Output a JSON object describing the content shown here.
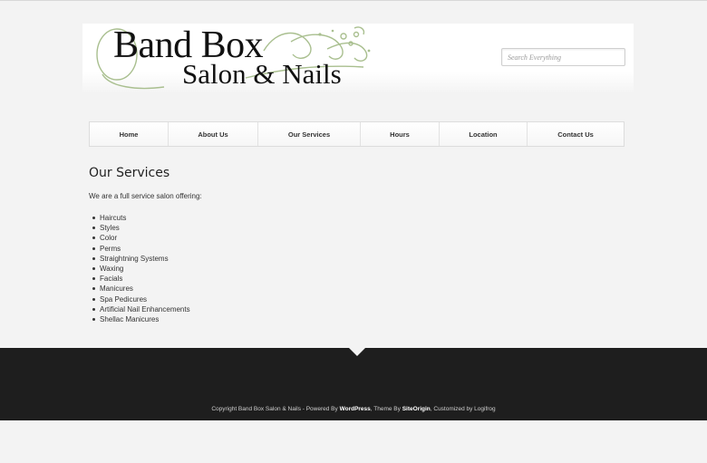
{
  "header": {
    "logo_line1": "Band Box",
    "logo_line2": "Salon & Nails",
    "search_placeholder": "Search Everything"
  },
  "nav": {
    "items": [
      {
        "label": "Home"
      },
      {
        "label": "About Us"
      },
      {
        "label": "Our Services"
      },
      {
        "label": "Hours"
      },
      {
        "label": "Location"
      },
      {
        "label": "Contact Us"
      }
    ]
  },
  "main": {
    "title": "Our Services",
    "intro": "We are a full service salon offering:",
    "services": [
      "Haircuts",
      "Styles",
      "Color",
      "Perms",
      "Straightning Systems",
      "Waxing",
      "Facials",
      "Manicures",
      "Spa Pedicures",
      "Artificial Nail Enhancements",
      "Shellac Manicures"
    ]
  },
  "footer": {
    "copyright": "Copyright Band Box Salon & Nails - Powered By ",
    "powered_link": "WordPress",
    "theme_text": ", Theme By ",
    "theme_link": "SiteOrigin",
    "customized_text": ", Customized by Logifrog"
  },
  "colors": {
    "page_background": "#f3f3f3",
    "footer_background": "#1e1e1e",
    "logo_flourish": "#a9bf8f"
  }
}
